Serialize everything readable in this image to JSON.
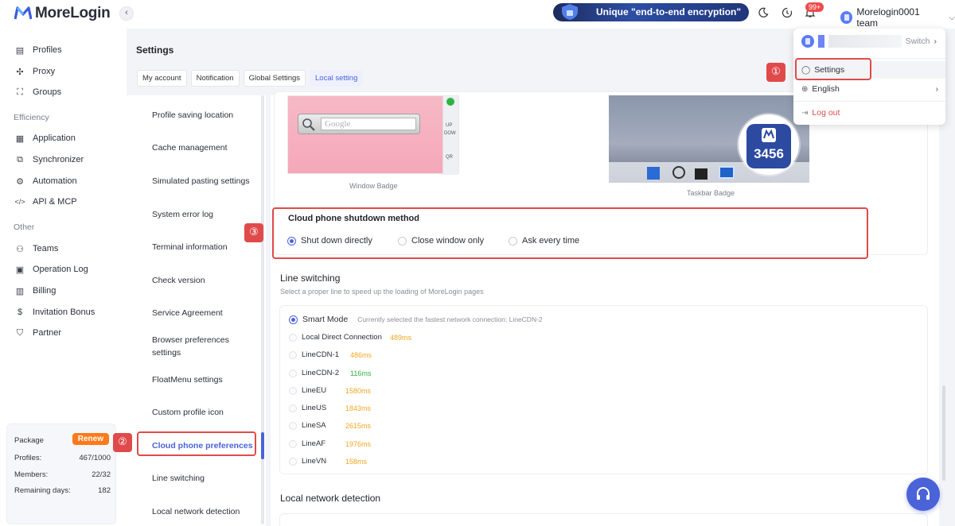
{
  "header": {
    "logo": "MoreLogin",
    "promo": "Unique \"end-to-end encryption\"",
    "notif_badge": "99+",
    "team_name": "Morelogin0001 team"
  },
  "sidebar": {
    "items_top": [
      {
        "label": "Profiles",
        "icon": "profile-icon"
      },
      {
        "label": "Proxy",
        "icon": "proxy-icon"
      },
      {
        "label": "Groups",
        "icon": "groups-icon"
      }
    ],
    "group_efficiency": "Efficiency",
    "items_eff": [
      {
        "label": "Application",
        "icon": "apps-icon"
      },
      {
        "label": "Synchronizer",
        "icon": "sync-icon"
      },
      {
        "label": "Automation",
        "icon": "automation-icon"
      },
      {
        "label": "API & MCP",
        "icon": "code-icon"
      }
    ],
    "group_other": "Other",
    "items_other": [
      {
        "label": "Teams",
        "icon": "teams-icon"
      },
      {
        "label": "Operation Log",
        "icon": "log-icon"
      },
      {
        "label": "Billing",
        "icon": "billing-icon"
      },
      {
        "label": "Invitation Bonus",
        "icon": "dollar-icon"
      },
      {
        "label": "Partner",
        "icon": "partner-icon"
      }
    ],
    "package": {
      "label": "Package",
      "renew": "Renew",
      "profiles_label": "Profiles:",
      "profiles_value": "467/1000",
      "members_label": "Members:",
      "members_value": "22/32",
      "days_label": "Remaining days:",
      "days_value": "182"
    }
  },
  "settings": {
    "title": "Settings",
    "tabs": [
      "My account",
      "Notification",
      "Global Settings",
      "Local setting"
    ],
    "menu": [
      "Profile saving location",
      "Cache management",
      "Simulated pasting settings",
      "System error log",
      "Terminal information",
      "Check version",
      "Service Agreement",
      "Browser preferences",
      "settings",
      "FloatMenu settings",
      "Custom profile icon",
      "Cloud phone preferences",
      "Line switching",
      "Local network detection"
    ]
  },
  "badge_preview": {
    "google_placeholder": "Google",
    "side_labels": [
      "UP",
      "DOW",
      "QR"
    ],
    "window_caption": "Window Badge",
    "taskbar_caption": "Taskbar Badge",
    "taskbar_number": "3456"
  },
  "shutdown": {
    "title": "Cloud phone shutdown method",
    "options": [
      "Shut down directly",
      "Close window only",
      "Ask every time"
    ],
    "selected": "Shut down directly"
  },
  "line_switching": {
    "title": "Line switching",
    "desc": "Select a proper line to speed up the loading of MoreLogin pages",
    "smart_label": "Smart Mode",
    "smart_note": "Currently selected the fastest network connection: LineCDN-2",
    "lines": [
      {
        "name": "Local Direct Connection",
        "ms": "489ms",
        "color": "#f5a623"
      },
      {
        "name": "LineCDN-1",
        "ms": "486ms",
        "color": "#f5a623"
      },
      {
        "name": "LineCDN-2",
        "ms": "116ms",
        "color": "#2fb344"
      },
      {
        "name": "LineEU",
        "ms": "1580ms",
        "color": "#f5a623"
      },
      {
        "name": "LineUS",
        "ms": "1843ms",
        "color": "#f5a623"
      },
      {
        "name": "LineSA",
        "ms": "2615ms",
        "color": "#f5a623"
      },
      {
        "name": "LineAF",
        "ms": "1976ms",
        "color": "#f5a623"
      },
      {
        "name": "LineVN",
        "ms": "158ms",
        "color": "#f5a623"
      }
    ]
  },
  "network_detection": {
    "title": "Local network detection"
  },
  "dropdown": {
    "switch": "Switch",
    "settings": "Settings",
    "language": "English",
    "logout": "Log out"
  },
  "annotations": [
    "①",
    "②",
    "③"
  ],
  "colors": {
    "accent": "#4a63d9",
    "highlight": "#e04a4a",
    "renew": "#ff7a1a"
  }
}
